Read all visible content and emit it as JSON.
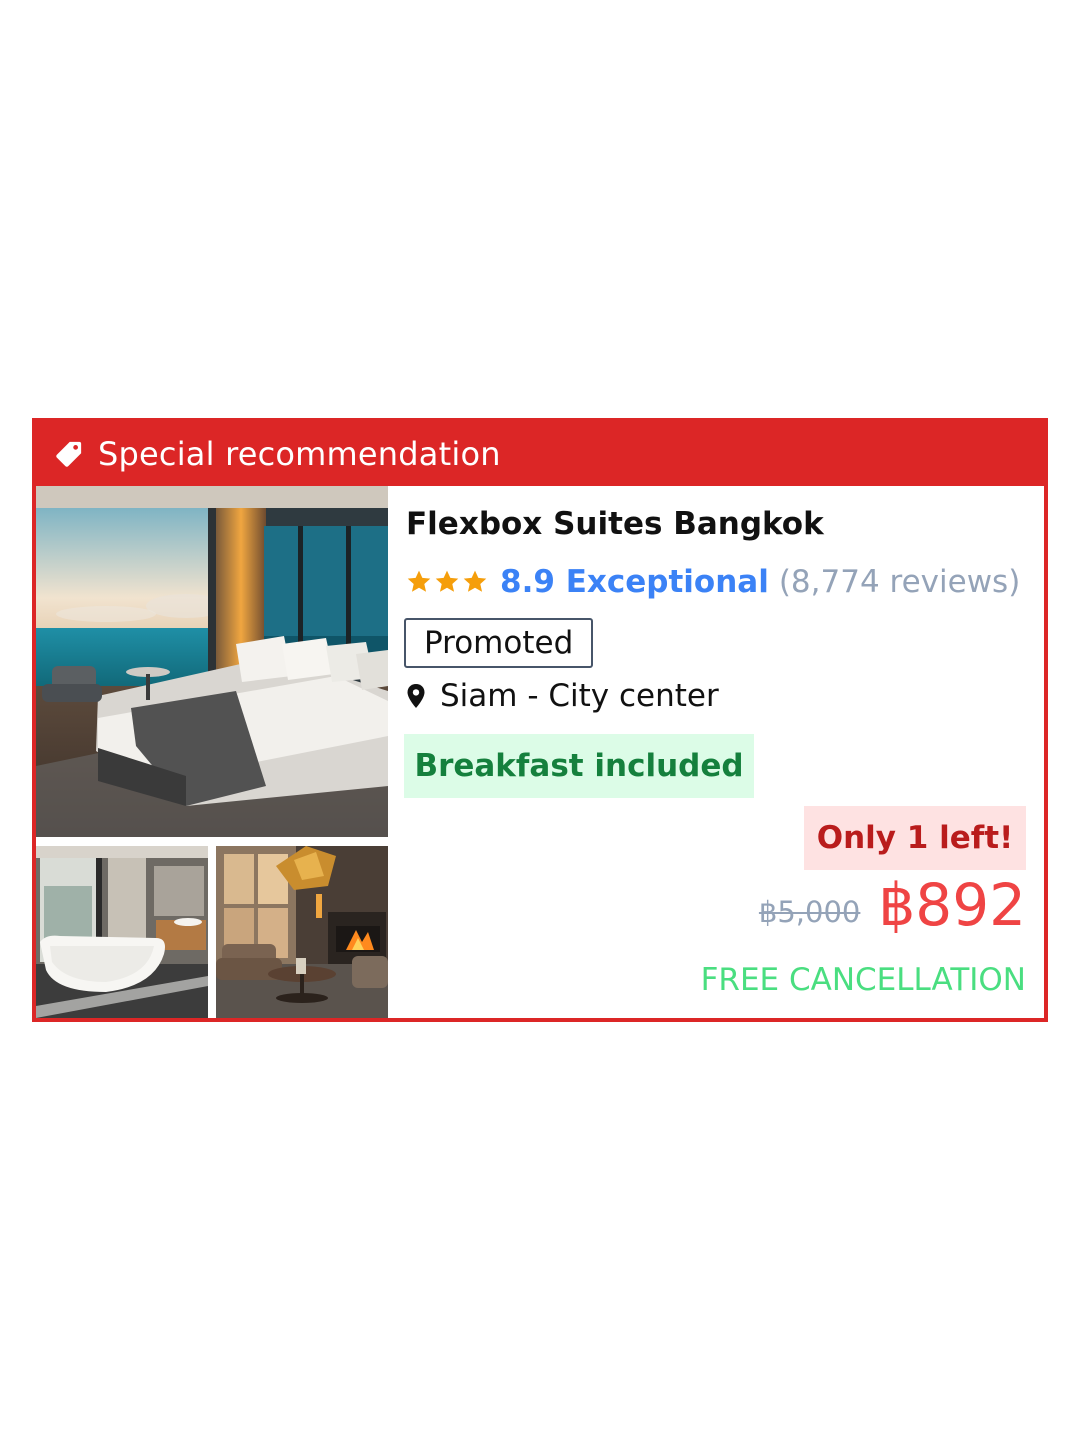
{
  "banner": {
    "icon": "tag-icon",
    "label": "Special recommendation",
    "color": "#dc2626"
  },
  "gallery": [
    {
      "name": "bedroom-ocean-view-photo"
    },
    {
      "name": "bathroom-tub-photo"
    },
    {
      "name": "lounge-fireplace-photo"
    }
  ],
  "hotel": {
    "name": "Flexbox Suites Bangkok",
    "stars": 3,
    "score_label": "8.9 Exceptional",
    "reviews": "(8,774 reviews)",
    "promoted": "Promoted",
    "location_icon": "map-pin-icon",
    "location": "Siam - City center",
    "breakfast": "Breakfast included",
    "availability": "Only 1 left!",
    "old_price": "฿5,000",
    "price": "฿892",
    "cancellation": "FREE CANCELLATION"
  },
  "colors": {
    "star": "#f59e0b",
    "score": "#3b82f6",
    "price": "#ef4444",
    "cancellation": "#4ade80",
    "breakfast_bg": "#dcfce7",
    "breakfast_text": "#15803d"
  }
}
